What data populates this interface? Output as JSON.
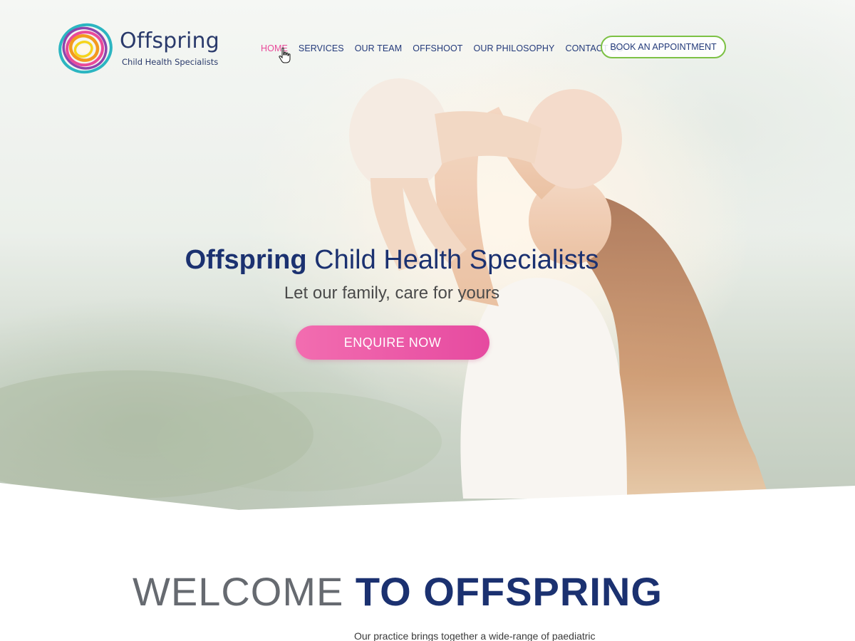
{
  "brand": {
    "name": "Offspring",
    "tagline": "Child Health Specialists",
    "logo_colors": [
      "#e94a9a",
      "#7cc144",
      "#f39a1e",
      "#2bb5c1",
      "#8e44ad",
      "#f6d41c"
    ]
  },
  "nav": {
    "items": [
      {
        "label": "HOME",
        "active": true
      },
      {
        "label": "SERVICES",
        "active": false
      },
      {
        "label": "OUR TEAM",
        "active": false
      },
      {
        "label": "OFFSHOOT",
        "active": false
      },
      {
        "label": "OUR PHILOSOPHY",
        "active": false
      },
      {
        "label": "CONTACT US",
        "active": false
      }
    ],
    "cta_label": "BOOK AN APPOINTMENT"
  },
  "hero": {
    "title_strong": "Offspring",
    "title_rest": " Child Health Specialists",
    "subtitle": "Let our family, care for yours",
    "button_label": "ENQUIRE NOW",
    "accent": "#e94a9a",
    "navy": "#1b3170"
  },
  "welcome": {
    "light": "WELCOME ",
    "bold": "TO OFFSPRING",
    "intro": "Our practice brings together a wide-range of paediatric"
  }
}
